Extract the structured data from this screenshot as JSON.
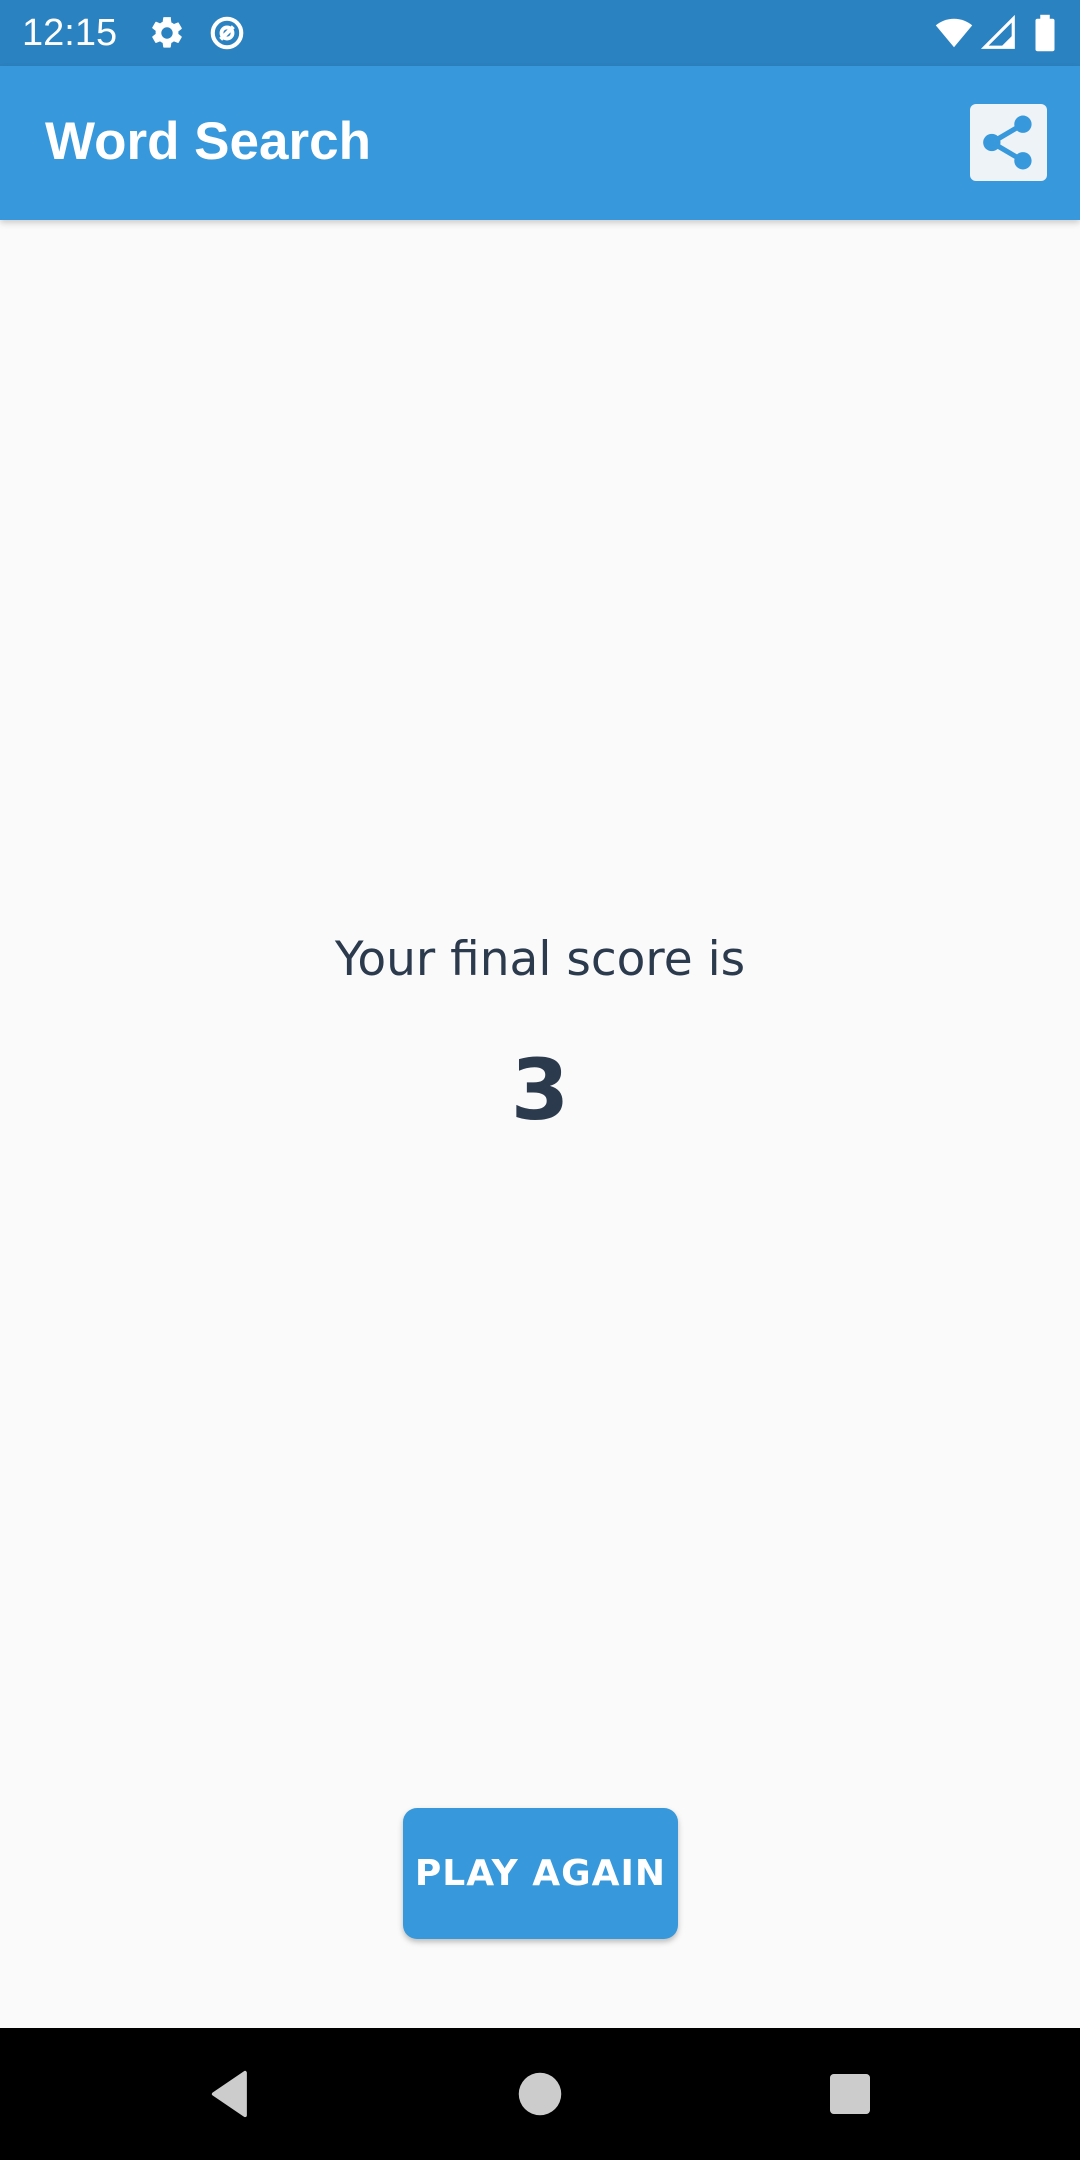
{
  "status_bar": {
    "time": "12:15",
    "icons": [
      "settings-gear-icon",
      "data-saver-icon",
      "wifi-icon",
      "cell-signal-icon",
      "battery-icon"
    ]
  },
  "app_bar": {
    "title": "Word Search",
    "share_icon": "share-icon"
  },
  "main": {
    "score_label": "Your final score is",
    "score_value": "3",
    "play_again_label": "PLAY AGAIN"
  },
  "nav_bar": {
    "icons": [
      "back-icon",
      "home-icon",
      "recents-icon"
    ]
  },
  "colors": {
    "status_bar": "#2b82c0",
    "app_bar": "#3799db",
    "background": "#fafafa",
    "text": "#2c3a4d"
  }
}
